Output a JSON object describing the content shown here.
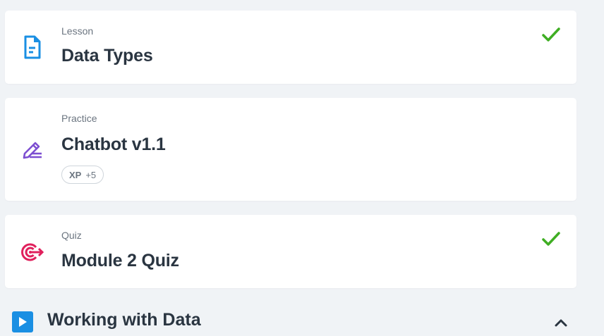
{
  "items": [
    {
      "kind": "Lesson",
      "title": "Data Types",
      "icon": "document-icon",
      "completed": true
    },
    {
      "kind": "Practice",
      "title": "Chatbot v1.1",
      "icon": "pencil-icon",
      "completed": false,
      "badge": {
        "label": "XP",
        "value": "+5"
      }
    },
    {
      "kind": "Quiz",
      "title": "Module 2 Quiz",
      "icon": "target-icon",
      "completed": true
    }
  ],
  "next_section": {
    "title": "Working with Data",
    "icon": "play-icon",
    "expanded": true
  },
  "colors": {
    "background": "#f0f3f6",
    "lesson_icon": "#1a8fe3",
    "practice_icon": "#7d4fd1",
    "quiz_icon": "#e0205c",
    "check": "#3fae23"
  }
}
